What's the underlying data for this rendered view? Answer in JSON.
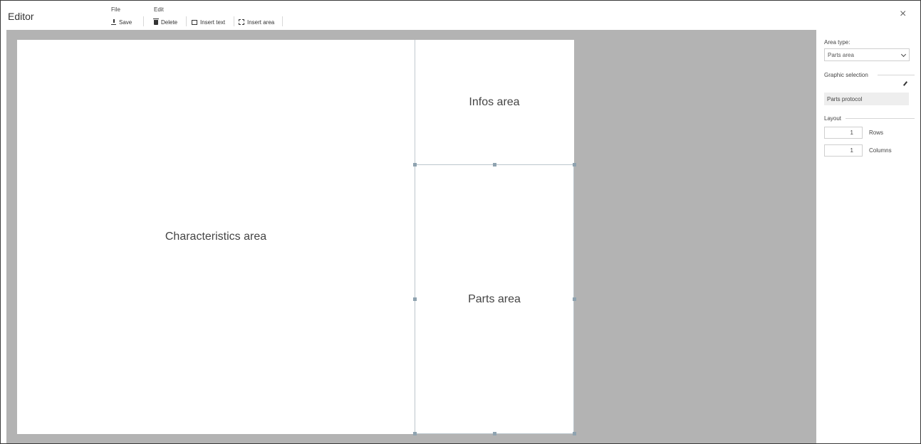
{
  "header": {
    "title": "Editor",
    "file_group": "File",
    "edit_group": "Edit",
    "save_label": "Save",
    "delete_label": "Delete",
    "insert_text_label": "Insert text",
    "insert_area_label": "Insert area",
    "close_symbol": "×"
  },
  "canvas": {
    "areas": {
      "characteristics": "Characteristics area",
      "infos": "Infos area",
      "parts": "Parts area"
    }
  },
  "panel": {
    "area_type_label": "Area type:",
    "area_type_value": "Parts area",
    "graphic_selection_label": "Graphic selection",
    "graphic_selection_value": "Parts protocol",
    "layout_label": "Layout",
    "rows_value": "1",
    "rows_label": "Rows",
    "columns_value": "1",
    "columns_label": "Columns"
  },
  "icons": {
    "save": "save-icon",
    "delete": "trash-icon",
    "insert_text": "text-box-icon",
    "insert_area": "area-box-icon",
    "edit": "pencil-icon",
    "dropdown": "chevron-down-icon",
    "close": "close-icon"
  }
}
